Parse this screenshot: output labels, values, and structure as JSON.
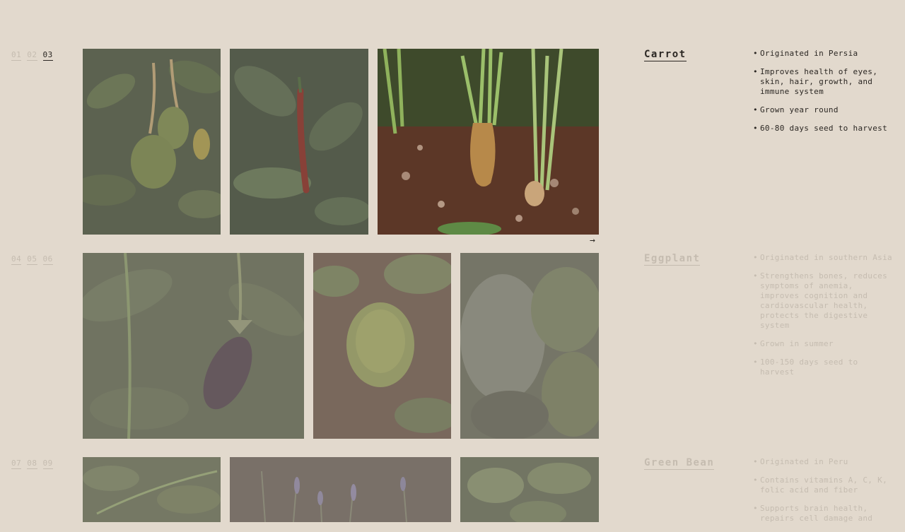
{
  "arrow": "→",
  "rows": [
    {
      "numbers": [
        "01",
        "02",
        "03"
      ],
      "active_number": 2,
      "name": "Carrot",
      "facts": [
        "Originated in Persia",
        "Improves health of eyes, skin, hair, growth, and immune system",
        "Grown year round",
        "60-80 days seed to harvest"
      ],
      "images": [
        "avocado-image",
        "chili-pepper-image",
        "carrot-image"
      ]
    },
    {
      "numbers": [
        "04",
        "05",
        "06"
      ],
      "name": "Eggplant",
      "facts": [
        "Originated in southern Asia",
        "Strengthens bones, reduces symptoms of anemia, improves cognition and cardiovascular health, protects the digestive system",
        "Grown in summer",
        "100-150 days seed to harvest"
      ],
      "images": [
        "eggplant-image",
        "lettuce-image",
        "herb-plant-image"
      ]
    },
    {
      "numbers": [
        "07",
        "08",
        "09"
      ],
      "name": "Green Bean",
      "facts": [
        "Originated in Peru",
        "Contains vitamins A, C, K, folic acid and fiber",
        "Supports brain health, repairs cell damage and"
      ],
      "images": [
        "bean-vine-image",
        "lavender-image",
        "bean-leaves-image"
      ]
    }
  ]
}
